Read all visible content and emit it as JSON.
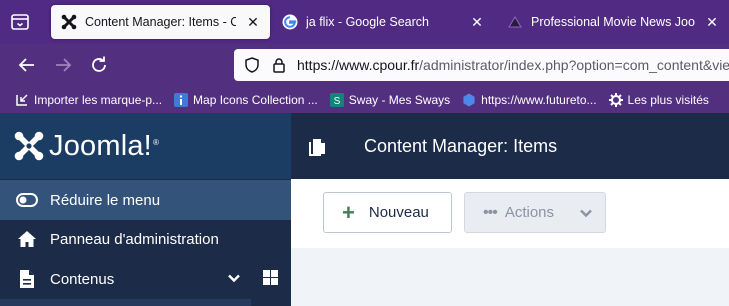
{
  "browser": {
    "tabs": [
      {
        "title": "Content Manager: Items - Cpour",
        "favicon": "joomla-icon",
        "active": true
      },
      {
        "title": "ja flix - Google Search",
        "favicon": "google-icon",
        "active": false
      },
      {
        "title": "Professional Movie News Joomla",
        "favicon": "joomla-dark-icon",
        "active": false
      }
    ],
    "url_host": "https://www.cpour.fr",
    "url_path": "/administrator/index.php?option=com_content&view=articles",
    "bookmarks": [
      {
        "label": "Importer les marque-p...",
        "icon": "import-icon"
      },
      {
        "label": "Map Icons Collection ...",
        "icon": "info-icon"
      },
      {
        "label": "Sway - Mes Sways",
        "icon": "sway-icon"
      },
      {
        "label": "https://www.futureto...",
        "icon": "hexagon-icon"
      },
      {
        "label": "Les plus visités",
        "icon": "gear-icon"
      }
    ]
  },
  "app": {
    "brand": "Joomla!",
    "brand_mark": "®",
    "header_title": "Content Manager: Items",
    "menu": [
      {
        "label": "Réduire le menu",
        "icon": "toggle-icon"
      },
      {
        "label": "Panneau d'administration",
        "icon": "home-icon"
      },
      {
        "label": "Contenus",
        "icon": "file-icon"
      }
    ],
    "toolbar": {
      "new_label": "Nouveau",
      "actions_label": "Actions"
    }
  },
  "colors": {
    "browser_chrome": "#512a84",
    "sidebar": "#1c2b47",
    "brand_bg": "#1c3d63",
    "active_menu": "#33537a",
    "new_plus": "#457d54"
  }
}
